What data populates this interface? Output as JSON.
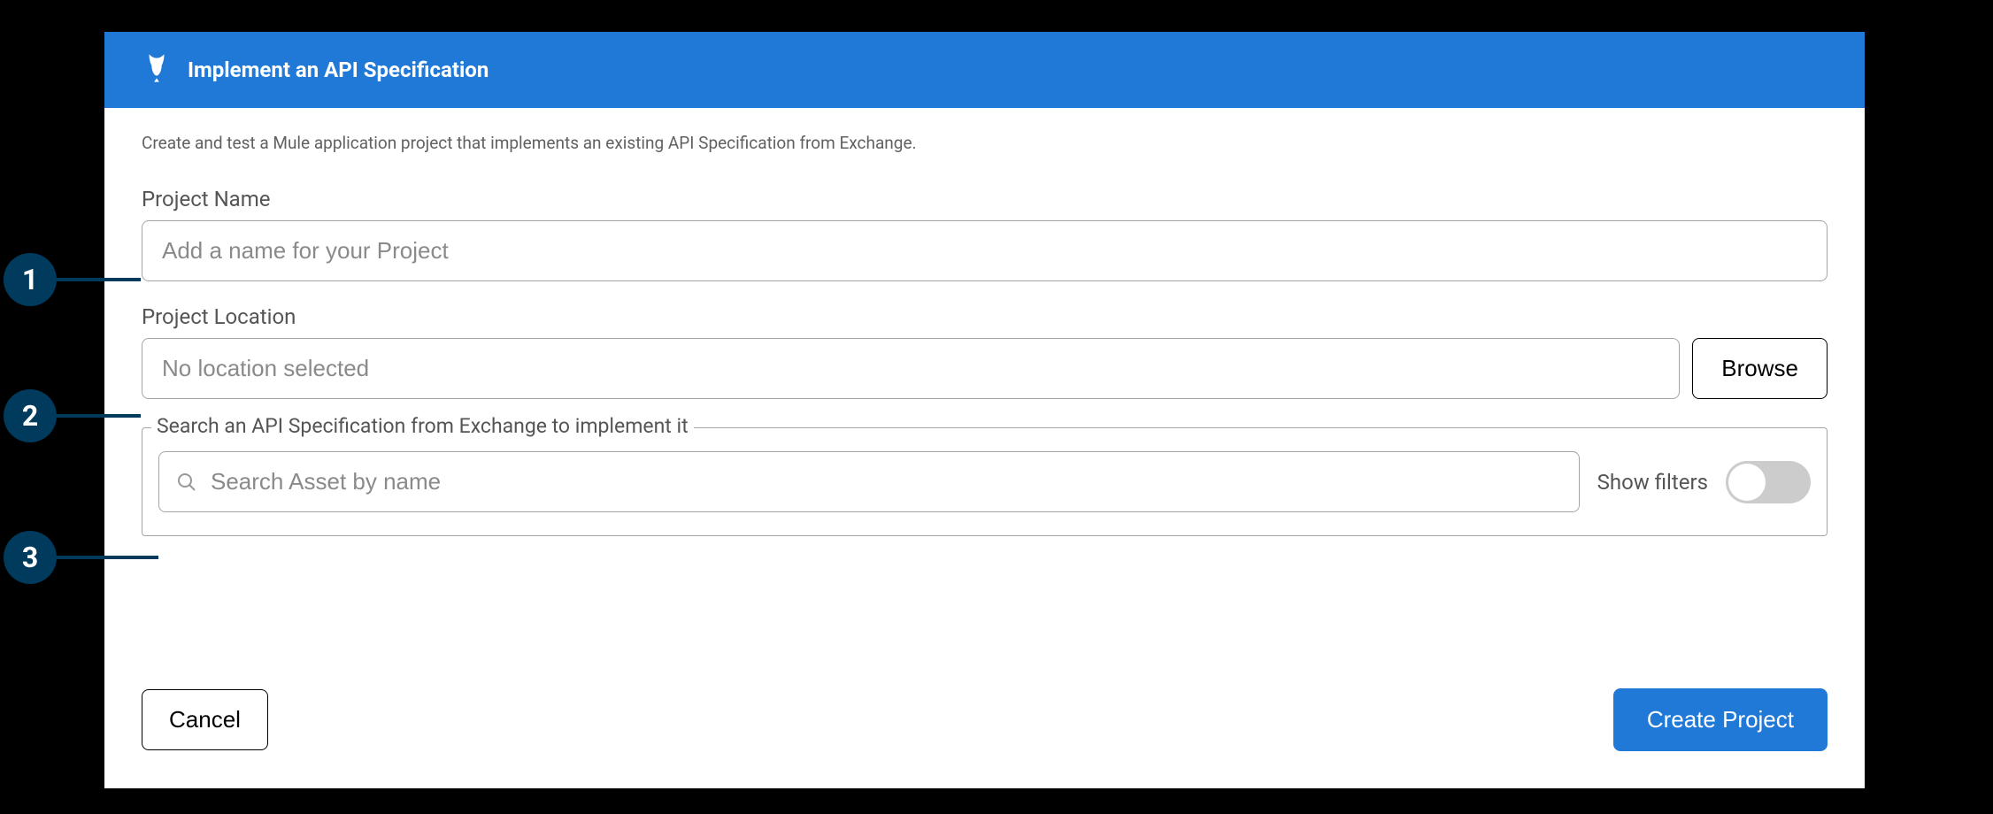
{
  "header": {
    "title": "Implement an API Specification"
  },
  "description": "Create and test a Mule application project that implements an existing API Specification from Exchange.",
  "projectName": {
    "label": "Project Name",
    "placeholder": "Add a name for your Project",
    "value": ""
  },
  "projectLocation": {
    "label": "Project Location",
    "placeholder": "No location selected",
    "value": "",
    "browseLabel": "Browse"
  },
  "searchSection": {
    "legend": "Search an API Specification from Exchange to implement it",
    "placeholder": "Search Asset by name",
    "value": "",
    "filterLabel": "Show filters",
    "filterOn": false
  },
  "footer": {
    "cancelLabel": "Cancel",
    "createLabel": "Create Project"
  },
  "callouts": {
    "c1": "1",
    "c2": "2",
    "c3": "3"
  }
}
